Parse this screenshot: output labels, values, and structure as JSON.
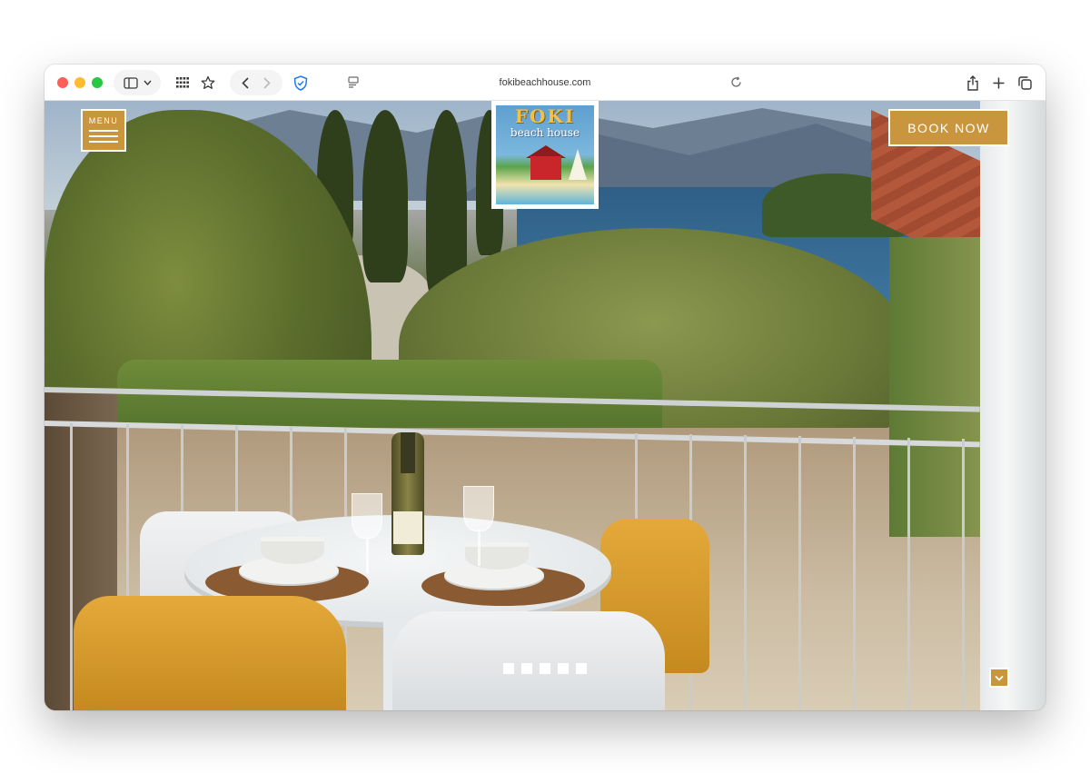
{
  "browser": {
    "url": "fokibeachhouse.com",
    "icons": [
      "sidebar-icon",
      "chevron-down-icon",
      "grid-icon",
      "star-icon",
      "back-icon",
      "forward-icon",
      "shield-icon",
      "page-icon",
      "reload-icon",
      "share-icon",
      "plus-icon",
      "tabs-icon"
    ]
  },
  "site": {
    "menu_label": "MENU",
    "logo": {
      "title": "FOKI",
      "subtitle": "beach house"
    },
    "book_label": "BOOK NOW",
    "slider": {
      "dot_count": 5
    },
    "colors": {
      "accent": "#c9963e",
      "white": "#ffffff"
    }
  }
}
